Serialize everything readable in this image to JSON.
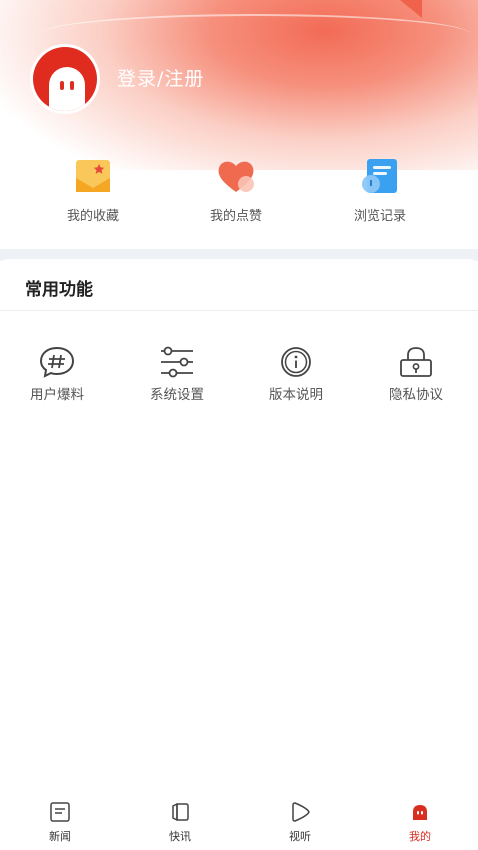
{
  "header": {
    "login_label": "登录/注册"
  },
  "quick_actions": [
    {
      "label": "我的收藏",
      "icon": "favorites-icon"
    },
    {
      "label": "我的点赞",
      "icon": "heart-icon"
    },
    {
      "label": "浏览记录",
      "icon": "history-icon"
    }
  ],
  "section": {
    "title": "常用功能"
  },
  "functions": [
    {
      "label": "用户爆料",
      "icon": "hashtag-chat-icon"
    },
    {
      "label": "系统设置",
      "icon": "sliders-icon"
    },
    {
      "label": "版本说明",
      "icon": "info-icon"
    },
    {
      "label": "隐私协议",
      "icon": "lock-icon"
    }
  ],
  "tabbar": {
    "items": [
      {
        "label": "新闻",
        "icon": "news-icon",
        "active": false
      },
      {
        "label": "快讯",
        "icon": "flash-news-icon",
        "active": false
      },
      {
        "label": "视听",
        "icon": "play-icon",
        "active": false
      },
      {
        "label": "我的",
        "icon": "profile-icon",
        "active": true
      }
    ]
  },
  "colors": {
    "accent": "#d92d20",
    "header_gradient": "#f26b55",
    "text_primary": "#222222",
    "text_secondary": "#555555"
  }
}
